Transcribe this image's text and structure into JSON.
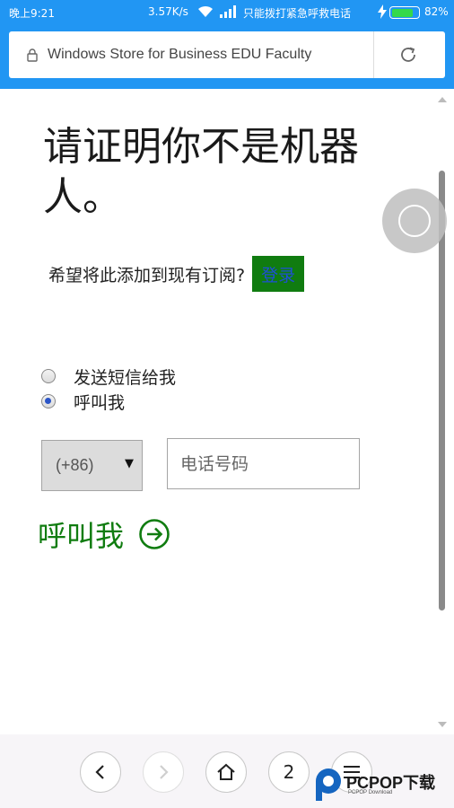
{
  "status_bar": {
    "time": "晚上9:21",
    "net_speed": "3.57K/s",
    "carrier_text": "只能拨打紧急呼救电话",
    "battery_pct": "82%",
    "battery_level": 0.82
  },
  "address_bar": {
    "url_title": "Windows Store for Business EDU Faculty"
  },
  "page": {
    "heading": "请证明你不是机器人。",
    "prompt": "希望将此添加到现有订阅?",
    "login_label": "登录",
    "options": [
      {
        "label": "发送短信给我",
        "checked": false
      },
      {
        "label": "呼叫我",
        "checked": true
      }
    ],
    "country_code": "(+86)",
    "phone_placeholder": "电话号码",
    "call_label": "呼叫我"
  },
  "bottom_nav": {
    "tab_count": "2"
  },
  "watermark": {
    "text": "PCPOP下载",
    "sub": "PCPOP Download"
  },
  "colors": {
    "accent_blue": "#2196f3",
    "ms_green": "#107c10",
    "link_blue": "#1e4fd6"
  }
}
